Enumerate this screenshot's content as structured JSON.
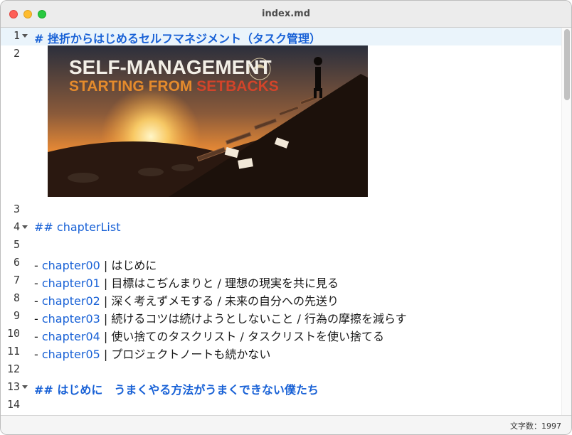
{
  "window": {
    "title": "index.md"
  },
  "editor": {
    "lines": [
      {
        "num": "1",
        "text": "# 挫折からはじめるセルフマネジメント（タスク管理）"
      },
      {
        "num": "2"
      },
      {
        "num": "3",
        "text": ""
      },
      {
        "num": "4",
        "text": "## chapterList"
      },
      {
        "num": "5",
        "text": ""
      },
      {
        "num": "6",
        "prefix": "- ",
        "link": "chapter00",
        "rest": " | はじめに"
      },
      {
        "num": "7",
        "prefix": "- ",
        "link": "chapter01",
        "rest": " | 目標はこぢんまりと / 理想の現実を共に見る"
      },
      {
        "num": "8",
        "prefix": "- ",
        "link": "chapter02",
        "rest": " | 深く考えずメモする / 未来の自分への先送り"
      },
      {
        "num": "9",
        "prefix": "- ",
        "link": "chapter03",
        "rest": " | 続けるコツは続けようとしないこと / 行為の摩擦を減らす"
      },
      {
        "num": "10",
        "prefix": "- ",
        "link": "chapter04",
        "rest": " | 使い捨てのタスクリスト / タスクリストを使い捨てる"
      },
      {
        "num": "11",
        "prefix": "- ",
        "link": "chapter05",
        "rest": " | プロジェクトノートも続かない"
      },
      {
        "num": "12",
        "text": ""
      },
      {
        "num": "13",
        "text": "## はじめに　うまくやる方法がうまくできない僕たち"
      },
      {
        "num": "14",
        "text": ""
      }
    ],
    "image": {
      "line1": "SELF-MANAGEMENT",
      "line2a": "STARTING FROM ",
      "line2b": "SETBACKS"
    }
  },
  "statusbar": {
    "char_count": "文字数：1997"
  },
  "colors": {
    "heading": "#1861d6",
    "link": "#1861d6",
    "active_line": "#eaf4fb"
  }
}
